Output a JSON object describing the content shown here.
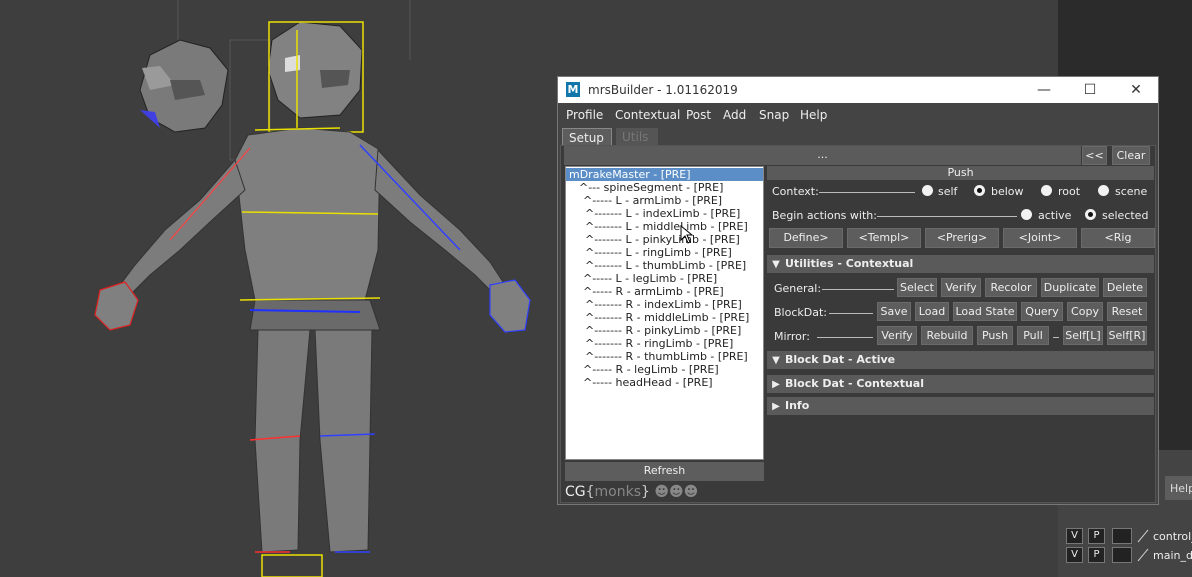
{
  "window": {
    "title": "mrsBuilder - 1.01162019",
    "logo": "M",
    "controls": {
      "minimize": "—",
      "maximize": "☐",
      "close": "✕"
    }
  },
  "menu": [
    "Profile",
    "Contextual",
    "Post",
    "Add",
    "Snap",
    "Help"
  ],
  "tabs": {
    "setup": "Setup",
    "utils": "Utils"
  },
  "toolbar": {
    "dots": "...",
    "back": "<<",
    "clear": "Clear"
  },
  "tree": [
    "mDrakeMaster - [PRE]",
    "^--- spineSegment - [PRE]",
    "^----- L - armLimb - [PRE]",
    "^------- L - indexLimb - [PRE]",
    "^------- L - middleLimb - [PRE]",
    "^------- L - pinkyLimb - [PRE]",
    "^------- L - ringLimb - [PRE]",
    "^------- L - thumbLimb - [PRE]",
    "^----- L - legLimb - [PRE]",
    "^----- R - armLimb - [PRE]",
    "^------- R - indexLimb - [PRE]",
    "^------- R - middleLimb - [PRE]",
    "^------- R - pinkyLimb - [PRE]",
    "^------- R - ringLimb - [PRE]",
    "^------- R - thumbLimb - [PRE]",
    "^----- R - legLimb - [PRE]",
    "^----- headHead - [PRE]"
  ],
  "refresh": "Refresh",
  "branding": {
    "prefix": "CG",
    "name": "monks"
  },
  "push": {
    "header": "Push",
    "context_label": "Context:",
    "context_options": [
      "self",
      "below",
      "root",
      "scene"
    ],
    "context_selected": "below",
    "begin_label": "Begin actions with:",
    "begin_options": [
      "active",
      "selected"
    ],
    "begin_selected": "selected",
    "buttons": [
      "Define>",
      "<Templ>",
      "<Prerig>",
      "<Joint>",
      "<Rig"
    ]
  },
  "utilities": {
    "header": "Utilities - Contextual",
    "general_label": "General:",
    "general_buttons": [
      "Select",
      "Verify",
      "Recolor",
      "Duplicate",
      "Delete"
    ],
    "blockdat_label": "BlockDat:",
    "blockdat_buttons": [
      "Save",
      "Load",
      "Load State",
      "Query",
      "Copy",
      "Reset"
    ],
    "mirror_label": "Mirror:",
    "mirror_buttons": [
      "Verify",
      "Rebuild",
      "Push",
      "Pull",
      "Self[L]",
      "Self[R]"
    ]
  },
  "sections": [
    "Block Dat - Active",
    "Block Dat - Contextual",
    "Info"
  ],
  "maya_side": {
    "help": "Help",
    "layers": [
      {
        "v": "V",
        "p": "P",
        "name": "control_"
      },
      {
        "v": "V",
        "p": "P",
        "name": "main_di"
      }
    ]
  }
}
